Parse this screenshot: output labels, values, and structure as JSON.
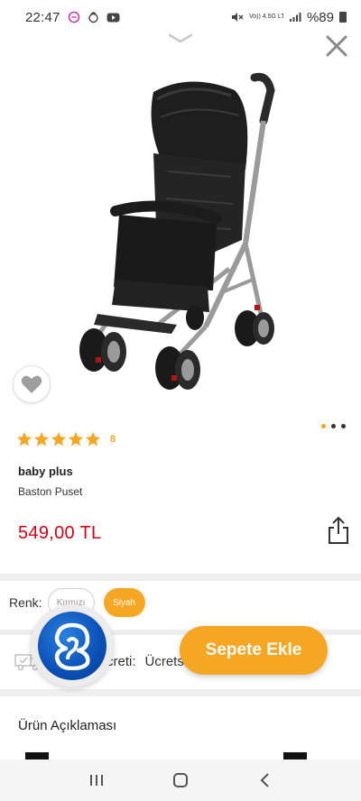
{
  "status_bar": {
    "time": "22:47",
    "network_label": "Vo)) 4.5G LTE1",
    "battery_percent": "%89"
  },
  "product": {
    "image_alt": "Baston Puset",
    "rating_stars": 5,
    "rating_count": "8",
    "brand": "baby plus",
    "name": "Baston Puset",
    "price": "549,00 TL",
    "gallery_dots": 3,
    "gallery_active_index": 0
  },
  "variants": {
    "label": "Renk:",
    "options": [
      {
        "label": "Kırmızı",
        "selected": false
      },
      {
        "label": "Siyah",
        "selected": true
      }
    ]
  },
  "shipping": {
    "label": "Kargo Ücreti:",
    "label_visible": "creti:",
    "value": "Ücretsiz"
  },
  "actions": {
    "add_to_cart": "Sepete Ekle"
  },
  "description": {
    "title": "Ürün Açıklaması"
  },
  "icons": {
    "close": "close-icon",
    "handle": "chevron-down-icon",
    "favorite": "heart-icon",
    "share": "share-icon",
    "truck": "truck-icon",
    "assistant": "assistant-logo-icon",
    "nav_recent": "recent-apps-icon",
    "nav_home": "home-icon",
    "nav_back": "back-icon"
  },
  "colors": {
    "accent": "#f5a623",
    "price": "#d0021b",
    "assistant": "#0a4fb5"
  }
}
